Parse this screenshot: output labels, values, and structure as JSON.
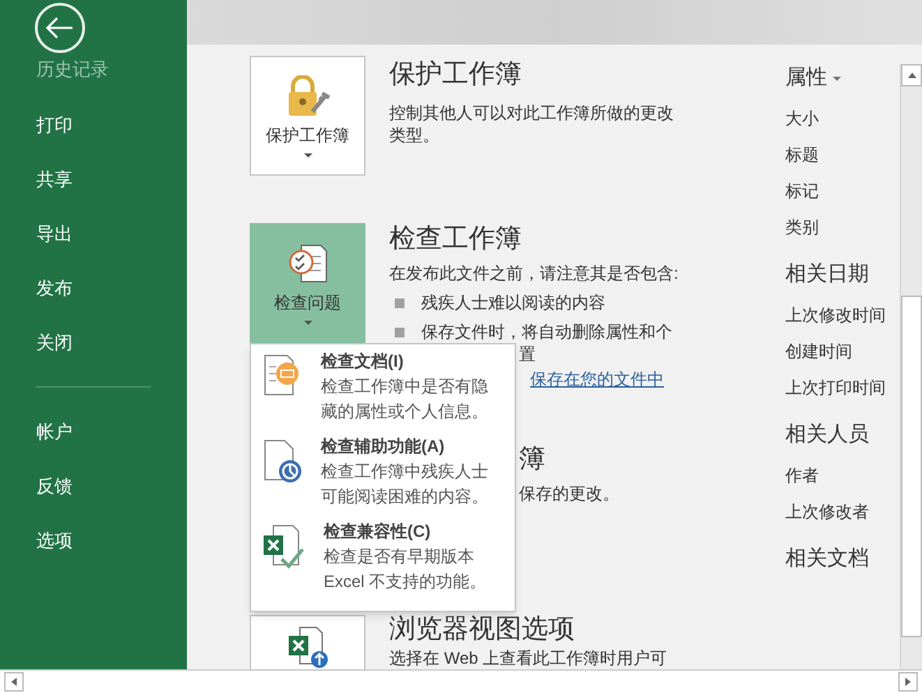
{
  "sidebar": {
    "groups": [
      {
        "items": [
          {
            "label": "历史记录",
            "disabled": true
          },
          {
            "label": "打印",
            "disabled": false
          },
          {
            "label": "共享",
            "disabled": false
          },
          {
            "label": "导出",
            "disabled": false
          },
          {
            "label": "发布",
            "disabled": false
          },
          {
            "label": "关闭",
            "disabled": false
          }
        ]
      },
      {
        "items": [
          {
            "label": "帐户",
            "disabled": false
          },
          {
            "label": "反馈",
            "disabled": false
          },
          {
            "label": "选项",
            "disabled": false
          }
        ]
      }
    ]
  },
  "protect": {
    "button_label": "保护工作簿",
    "selected": false,
    "title": "保护工作簿",
    "description": "控制其他人可以对此工作簿所做的更改类型。"
  },
  "inspect": {
    "button_label": "检查问题",
    "selected": true,
    "title": "检查工作簿",
    "intro": "在发布此文件之前，请注意其是否包含:",
    "bullets": [
      "残疾人士难以阅读的内容",
      "保存文件时，将自动删除属性和个"
    ],
    "continuation": "置",
    "link": "保存在您的文件中"
  },
  "manage": {
    "title": "簿",
    "description": "保存的更改。"
  },
  "browser_view": {
    "title": "浏览器视图选项",
    "description": "选择在 Web 上查看此工作簿时用户可"
  },
  "inspect_menu": {
    "items": [
      {
        "kind": "document",
        "title": "检查文档(I)",
        "description": "检查工作簿中是否有隐藏的属性或个人信息。"
      },
      {
        "kind": "accessibility",
        "title": "检查辅助功能(A)",
        "description": "检查工作簿中残疾人士可能阅读困难的内容。"
      },
      {
        "kind": "compatibility",
        "title": "检查兼容性(C)",
        "description": "检查是否有早期版本Excel 不支持的功能。"
      }
    ]
  },
  "properties": {
    "groups": [
      {
        "title": "属性",
        "dropdown": true,
        "items": [
          "大小",
          "标题",
          "标记",
          "类别"
        ]
      },
      {
        "title": "相关日期",
        "dropdown": false,
        "items": [
          "上次修改时间",
          "创建时间",
          "上次打印时间"
        ]
      },
      {
        "title": "相关人员",
        "dropdown": false,
        "items": [
          "作者",
          "上次修改者"
        ]
      },
      {
        "title": "相关文档",
        "dropdown": false
      }
    ]
  }
}
